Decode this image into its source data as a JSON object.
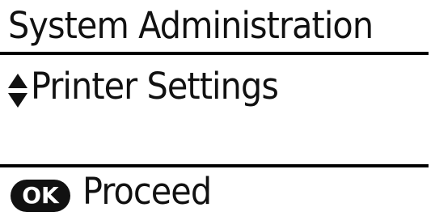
{
  "screen": {
    "title": "System Administration",
    "selected_item": {
      "label": "Printer Settings",
      "icon": "up-down-arrows-icon"
    },
    "footer": {
      "ok_icon_label": "OK",
      "action_label": "Proceed"
    }
  }
}
